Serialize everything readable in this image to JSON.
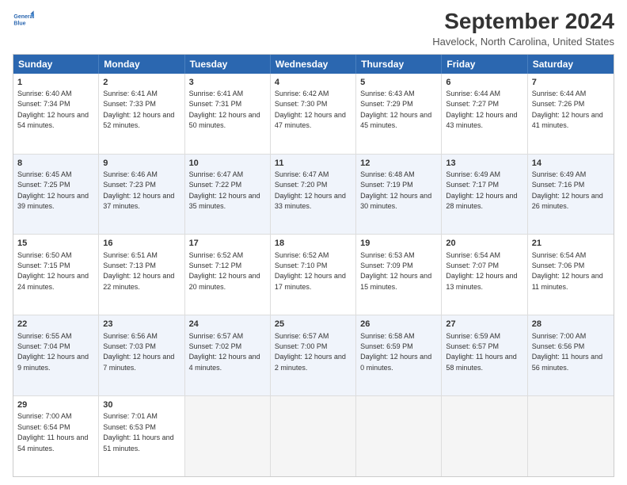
{
  "header": {
    "logo_line1": "General",
    "logo_line2": "Blue",
    "month": "September 2024",
    "location": "Havelock, North Carolina, United States"
  },
  "days_of_week": [
    "Sunday",
    "Monday",
    "Tuesday",
    "Wednesday",
    "Thursday",
    "Friday",
    "Saturday"
  ],
  "weeks": [
    [
      {
        "day": "1",
        "rise": "6:40 AM",
        "set": "7:34 PM",
        "daylight": "12 hours and 54 minutes."
      },
      {
        "day": "2",
        "rise": "6:41 AM",
        "set": "7:33 PM",
        "daylight": "12 hours and 52 minutes."
      },
      {
        "day": "3",
        "rise": "6:41 AM",
        "set": "7:31 PM",
        "daylight": "12 hours and 50 minutes."
      },
      {
        "day": "4",
        "rise": "6:42 AM",
        "set": "7:30 PM",
        "daylight": "12 hours and 47 minutes."
      },
      {
        "day": "5",
        "rise": "6:43 AM",
        "set": "7:29 PM",
        "daylight": "12 hours and 45 minutes."
      },
      {
        "day": "6",
        "rise": "6:44 AM",
        "set": "7:27 PM",
        "daylight": "12 hours and 43 minutes."
      },
      {
        "day": "7",
        "rise": "6:44 AM",
        "set": "7:26 PM",
        "daylight": "12 hours and 41 minutes."
      }
    ],
    [
      {
        "day": "8",
        "rise": "6:45 AM",
        "set": "7:25 PM",
        "daylight": "12 hours and 39 minutes."
      },
      {
        "day": "9",
        "rise": "6:46 AM",
        "set": "7:23 PM",
        "daylight": "12 hours and 37 minutes."
      },
      {
        "day": "10",
        "rise": "6:47 AM",
        "set": "7:22 PM",
        "daylight": "12 hours and 35 minutes."
      },
      {
        "day": "11",
        "rise": "6:47 AM",
        "set": "7:20 PM",
        "daylight": "12 hours and 33 minutes."
      },
      {
        "day": "12",
        "rise": "6:48 AM",
        "set": "7:19 PM",
        "daylight": "12 hours and 30 minutes."
      },
      {
        "day": "13",
        "rise": "6:49 AM",
        "set": "7:17 PM",
        "daylight": "12 hours and 28 minutes."
      },
      {
        "day": "14",
        "rise": "6:49 AM",
        "set": "7:16 PM",
        "daylight": "12 hours and 26 minutes."
      }
    ],
    [
      {
        "day": "15",
        "rise": "6:50 AM",
        "set": "7:15 PM",
        "daylight": "12 hours and 24 minutes."
      },
      {
        "day": "16",
        "rise": "6:51 AM",
        "set": "7:13 PM",
        "daylight": "12 hours and 22 minutes."
      },
      {
        "day": "17",
        "rise": "6:52 AM",
        "set": "7:12 PM",
        "daylight": "12 hours and 20 minutes."
      },
      {
        "day": "18",
        "rise": "6:52 AM",
        "set": "7:10 PM",
        "daylight": "12 hours and 17 minutes."
      },
      {
        "day": "19",
        "rise": "6:53 AM",
        "set": "7:09 PM",
        "daylight": "12 hours and 15 minutes."
      },
      {
        "day": "20",
        "rise": "6:54 AM",
        "set": "7:07 PM",
        "daylight": "12 hours and 13 minutes."
      },
      {
        "day": "21",
        "rise": "6:54 AM",
        "set": "7:06 PM",
        "daylight": "12 hours and 11 minutes."
      }
    ],
    [
      {
        "day": "22",
        "rise": "6:55 AM",
        "set": "7:04 PM",
        "daylight": "12 hours and 9 minutes."
      },
      {
        "day": "23",
        "rise": "6:56 AM",
        "set": "7:03 PM",
        "daylight": "12 hours and 7 minutes."
      },
      {
        "day": "24",
        "rise": "6:57 AM",
        "set": "7:02 PM",
        "daylight": "12 hours and 4 minutes."
      },
      {
        "day": "25",
        "rise": "6:57 AM",
        "set": "7:00 PM",
        "daylight": "12 hours and 2 minutes."
      },
      {
        "day": "26",
        "rise": "6:58 AM",
        "set": "6:59 PM",
        "daylight": "12 hours and 0 minutes."
      },
      {
        "day": "27",
        "rise": "6:59 AM",
        "set": "6:57 PM",
        "daylight": "11 hours and 58 minutes."
      },
      {
        "day": "28",
        "rise": "7:00 AM",
        "set": "6:56 PM",
        "daylight": "11 hours and 56 minutes."
      }
    ],
    [
      {
        "day": "29",
        "rise": "7:00 AM",
        "set": "6:54 PM",
        "daylight": "11 hours and 54 minutes."
      },
      {
        "day": "30",
        "rise": "7:01 AM",
        "set": "6:53 PM",
        "daylight": "11 hours and 51 minutes."
      },
      {
        "day": "",
        "rise": "",
        "set": "",
        "daylight": ""
      },
      {
        "day": "",
        "rise": "",
        "set": "",
        "daylight": ""
      },
      {
        "day": "",
        "rise": "",
        "set": "",
        "daylight": ""
      },
      {
        "day": "",
        "rise": "",
        "set": "",
        "daylight": ""
      },
      {
        "day": "",
        "rise": "",
        "set": "",
        "daylight": ""
      }
    ]
  ],
  "colors": {
    "header_bg": "#2b67b0",
    "alt_row_bg": "#f0f4fb",
    "empty_bg": "#f5f5f5"
  }
}
